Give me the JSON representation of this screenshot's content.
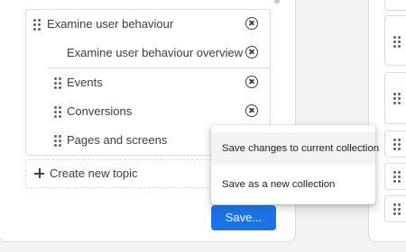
{
  "topic_editor": {
    "topic": {
      "label": "Examine user behaviour",
      "children": [
        {
          "label": "Examine user behaviour overview"
        },
        {
          "label": "Events"
        },
        {
          "label": "Conversions"
        },
        {
          "label": "Pages and screens"
        }
      ]
    },
    "create_topic_label": "Create new topic",
    "save_button_label": "Save..."
  },
  "save_menu": {
    "items": [
      {
        "label": "Save changes to current collection",
        "highlighted": true
      },
      {
        "label": "Save as a new collection",
        "highlighted": false
      }
    ]
  },
  "colors": {
    "primary_button": "#1a73e8",
    "text": "#3c4043",
    "border": "#dadce0",
    "background": "#f1f3f4"
  }
}
